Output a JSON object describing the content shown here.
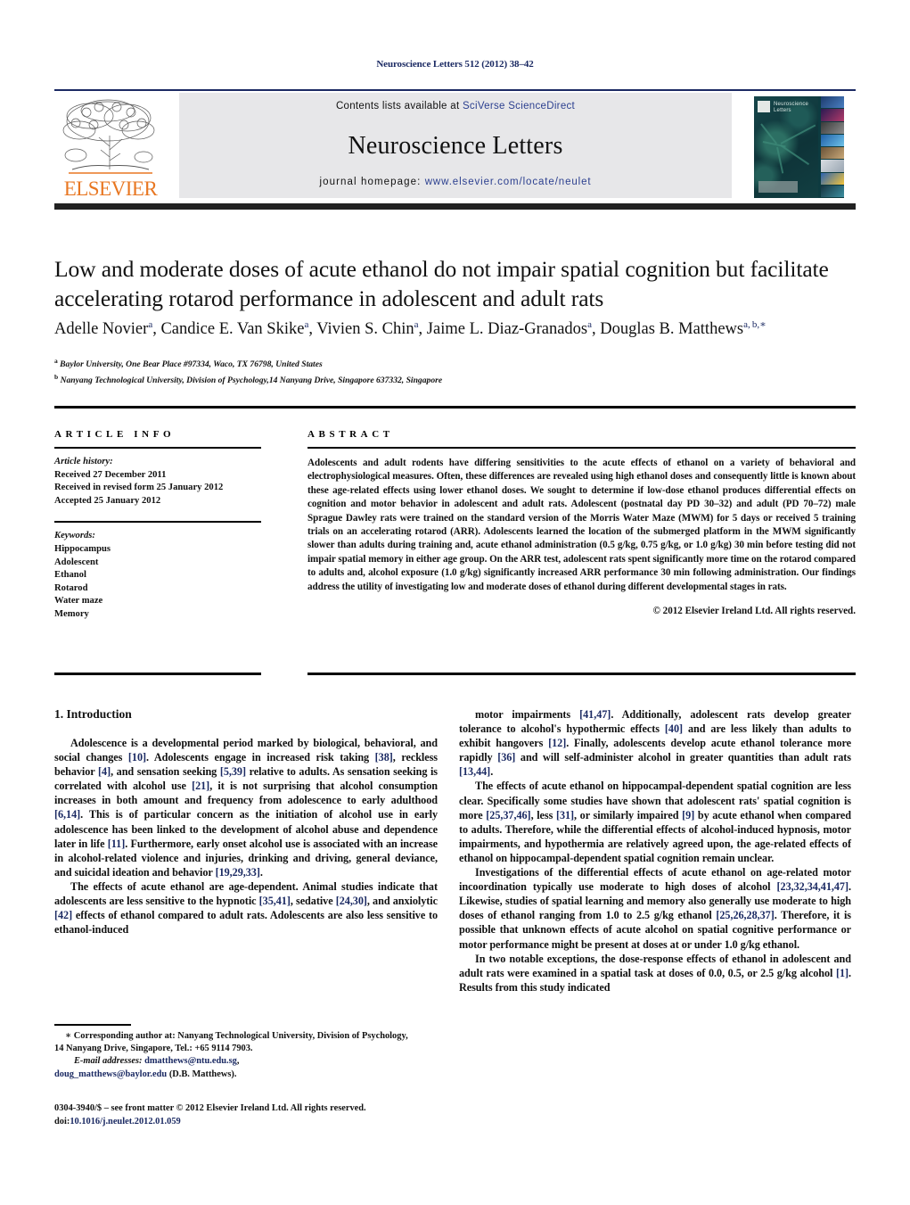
{
  "running_head": "Neuroscience Letters 512 (2012) 38–42",
  "header": {
    "contents_prefix": "Contents lists available at ",
    "contents_link": "SciVerse ScienceDirect",
    "journal_name": "Neuroscience Letters",
    "homepage_prefix": "journal homepage: ",
    "homepage_link": "www.elsevier.com/locate/neulet",
    "publisher_logo_text": "ELSEVIER",
    "cover_title_line1": "Neuroscience",
    "cover_title_line2": "Letters",
    "link_color": "#2b3f8f",
    "band_bg": "#e7e7e9",
    "rule_color": "#1b2a63"
  },
  "article": {
    "title": "Low and moderate doses of acute ethanol do not impair spatial cognition but facilitate accelerating rotarod performance in adolescent and adult rats",
    "authors_html": "Adelle Novier<sup>a</sup>, Candice E. Van Skike<sup>a</sup>, Vivien S. Chin<sup>a</sup>, Jaime L. Diaz-Granados<sup>a</sup>, Douglas B. Matthews<sup>a, b,</sup><sup>∗</sup>",
    "affiliation_a": "Baylor University, One Bear Place #97334, Waco, TX 76798, United States",
    "affiliation_b": "Nanyang Technological University, Division of Psychology,14 Nanyang Drive, Singapore 637332, Singapore"
  },
  "info": {
    "heading": "ARTICLE INFO",
    "history_label": "Article history:",
    "history": [
      "Received 27 December 2011",
      "Received in revised form 25 January 2012",
      "Accepted 25 January 2012"
    ],
    "keywords_label": "Keywords:",
    "keywords": [
      "Hippocampus",
      "Adolescent",
      "Ethanol",
      "Rotarod",
      "Water maze",
      "Memory"
    ]
  },
  "abstract": {
    "heading": "ABSTRACT",
    "body": "Adolescents and adult rodents have differing sensitivities to the acute effects of ethanol on a variety of behavioral and electrophysiological measures. Often, these differences are revealed using high ethanol doses and consequently little is known about these age-related effects using lower ethanol doses. We sought to determine if low-dose ethanol produces differential effects on cognition and motor behavior in adolescent and adult rats. Adolescent (postnatal day PD 30–32) and adult (PD 70–72) male Sprague Dawley rats were trained on the standard version of the Morris Water Maze (MWM) for 5 days or received 5 training trials on an accelerating rotarod (ARR). Adolescents learned the location of the submerged platform in the MWM significantly slower than adults during training and, acute ethanol administration (0.5 g/kg, 0.75 g/kg, or 1.0 g/kg) 30 min before testing did not impair spatial memory in either age group. On the ARR test, adolescent rats spent significantly more time on the rotarod compared to adults and, alcohol exposure (1.0 g/kg) significantly increased ARR performance 30 min following administration. Our findings address the utility of investigating low and moderate doses of ethanol during different developmental stages in rats.",
    "copyright": "© 2012 Elsevier Ireland Ltd. All rights reserved."
  },
  "body": {
    "section_heading": "1. Introduction",
    "left_paragraphs": [
      "Adolescence is a developmental period marked by biological, behavioral, and social changes <span class=\"ref\">[10]</span>. Adolescents engage in increased risk taking <span class=\"ref\">[38]</span>, reckless behavior <span class=\"ref\">[4]</span>, and sensation seeking <span class=\"ref\">[5,39]</span> relative to adults. As sensation seeking is correlated with alcohol use <span class=\"ref\">[21]</span>, it is not surprising that alcohol consumption increases in both amount and frequency from adolescence to early adulthood <span class=\"ref\">[6,14]</span>. This is of particular concern as the initiation of alcohol use in early adolescence has been linked to the development of alcohol abuse and dependence later in life <span class=\"ref\">[11]</span>. Furthermore, early onset alcohol use is associated with an increase in alcohol-related violence and injuries, drinking and driving, general deviance, and suicidal ideation and behavior <span class=\"ref\">[19,29,33]</span>.",
      "The effects of acute ethanol are age-dependent. Animal studies indicate that adolescents are less sensitive to the hypnotic <span class=\"ref\">[35,41]</span>, sedative <span class=\"ref\">[24,30]</span>, and anxiolytic <span class=\"ref\">[42]</span> effects of ethanol compared to adult rats. Adolescents are also less sensitive to ethanol-induced"
    ],
    "right_paragraphs": [
      "motor impairments <span class=\"ref\">[41,47]</span>. Additionally, adolescent rats develop greater tolerance to alcohol's hypothermic effects <span class=\"ref\">[40]</span> and are less likely than adults to exhibit hangovers <span class=\"ref\">[12]</span>. Finally, adolescents develop acute ethanol tolerance more rapidly <span class=\"ref\">[36]</span> and will self-administer alcohol in greater quantities than adult rats <span class=\"ref\">[13,44]</span>.",
      "The effects of acute ethanol on hippocampal-dependent spatial cognition are less clear. Specifically some studies have shown that adolescent rats' spatial cognition is more <span class=\"ref\">[25,37,46]</span>, less <span class=\"ref\">[31]</span>, or similarly impaired <span class=\"ref\">[9]</span> by acute ethanol when compared to adults. Therefore, while the differential effects of alcohol-induced hypnosis, motor impairments, and hypothermia are relatively agreed upon, the age-related effects of ethanol on hippocampal-dependent spatial cognition remain unclear.",
      "Investigations of the differential effects of acute ethanol on age-related motor incoordination typically use moderate to high doses of alcohol <span class=\"ref\">[23,32,34,41,47]</span>. Likewise, studies of spatial learning and memory also generally use moderate to high doses of ethanol ranging from 1.0 to 2.5 g/kg ethanol <span class=\"ref\">[25,26,28,37]</span>. Therefore, it is possible that unknown effects of acute alcohol on spatial cognitive performance or motor performance might be present at doses at or under 1.0 g/kg ethanol.",
      "In two notable exceptions, the dose-response effects of ethanol in adolescent and adult rats were examined in a spatial task at doses of 0.0, 0.5, or 2.5 g/kg alcohol <span class=\"ref\">[1]</span>. Results from this study indicated"
    ]
  },
  "footnote": {
    "corresponding": "<span class=\"em\">∗</span> Corresponding author at: Nanyang Technological University, Division of Psychology, 14 Nanyang Drive, Singapore, Tel.: +65 9114 7903.",
    "email_label": "E-mail addresses:",
    "email_1": "dmatthews@ntu.edu.sg",
    "email_2": "doug_matthews@baylor.edu",
    "email_owner": "(D.B. Matthews)."
  },
  "imprint": {
    "line1": "0304-3940/$ – see front matter © 2012 Elsevier Ireland Ltd. All rights reserved.",
    "doi_label": "doi:",
    "doi_value": "10.1016/j.neulet.2012.01.059"
  }
}
